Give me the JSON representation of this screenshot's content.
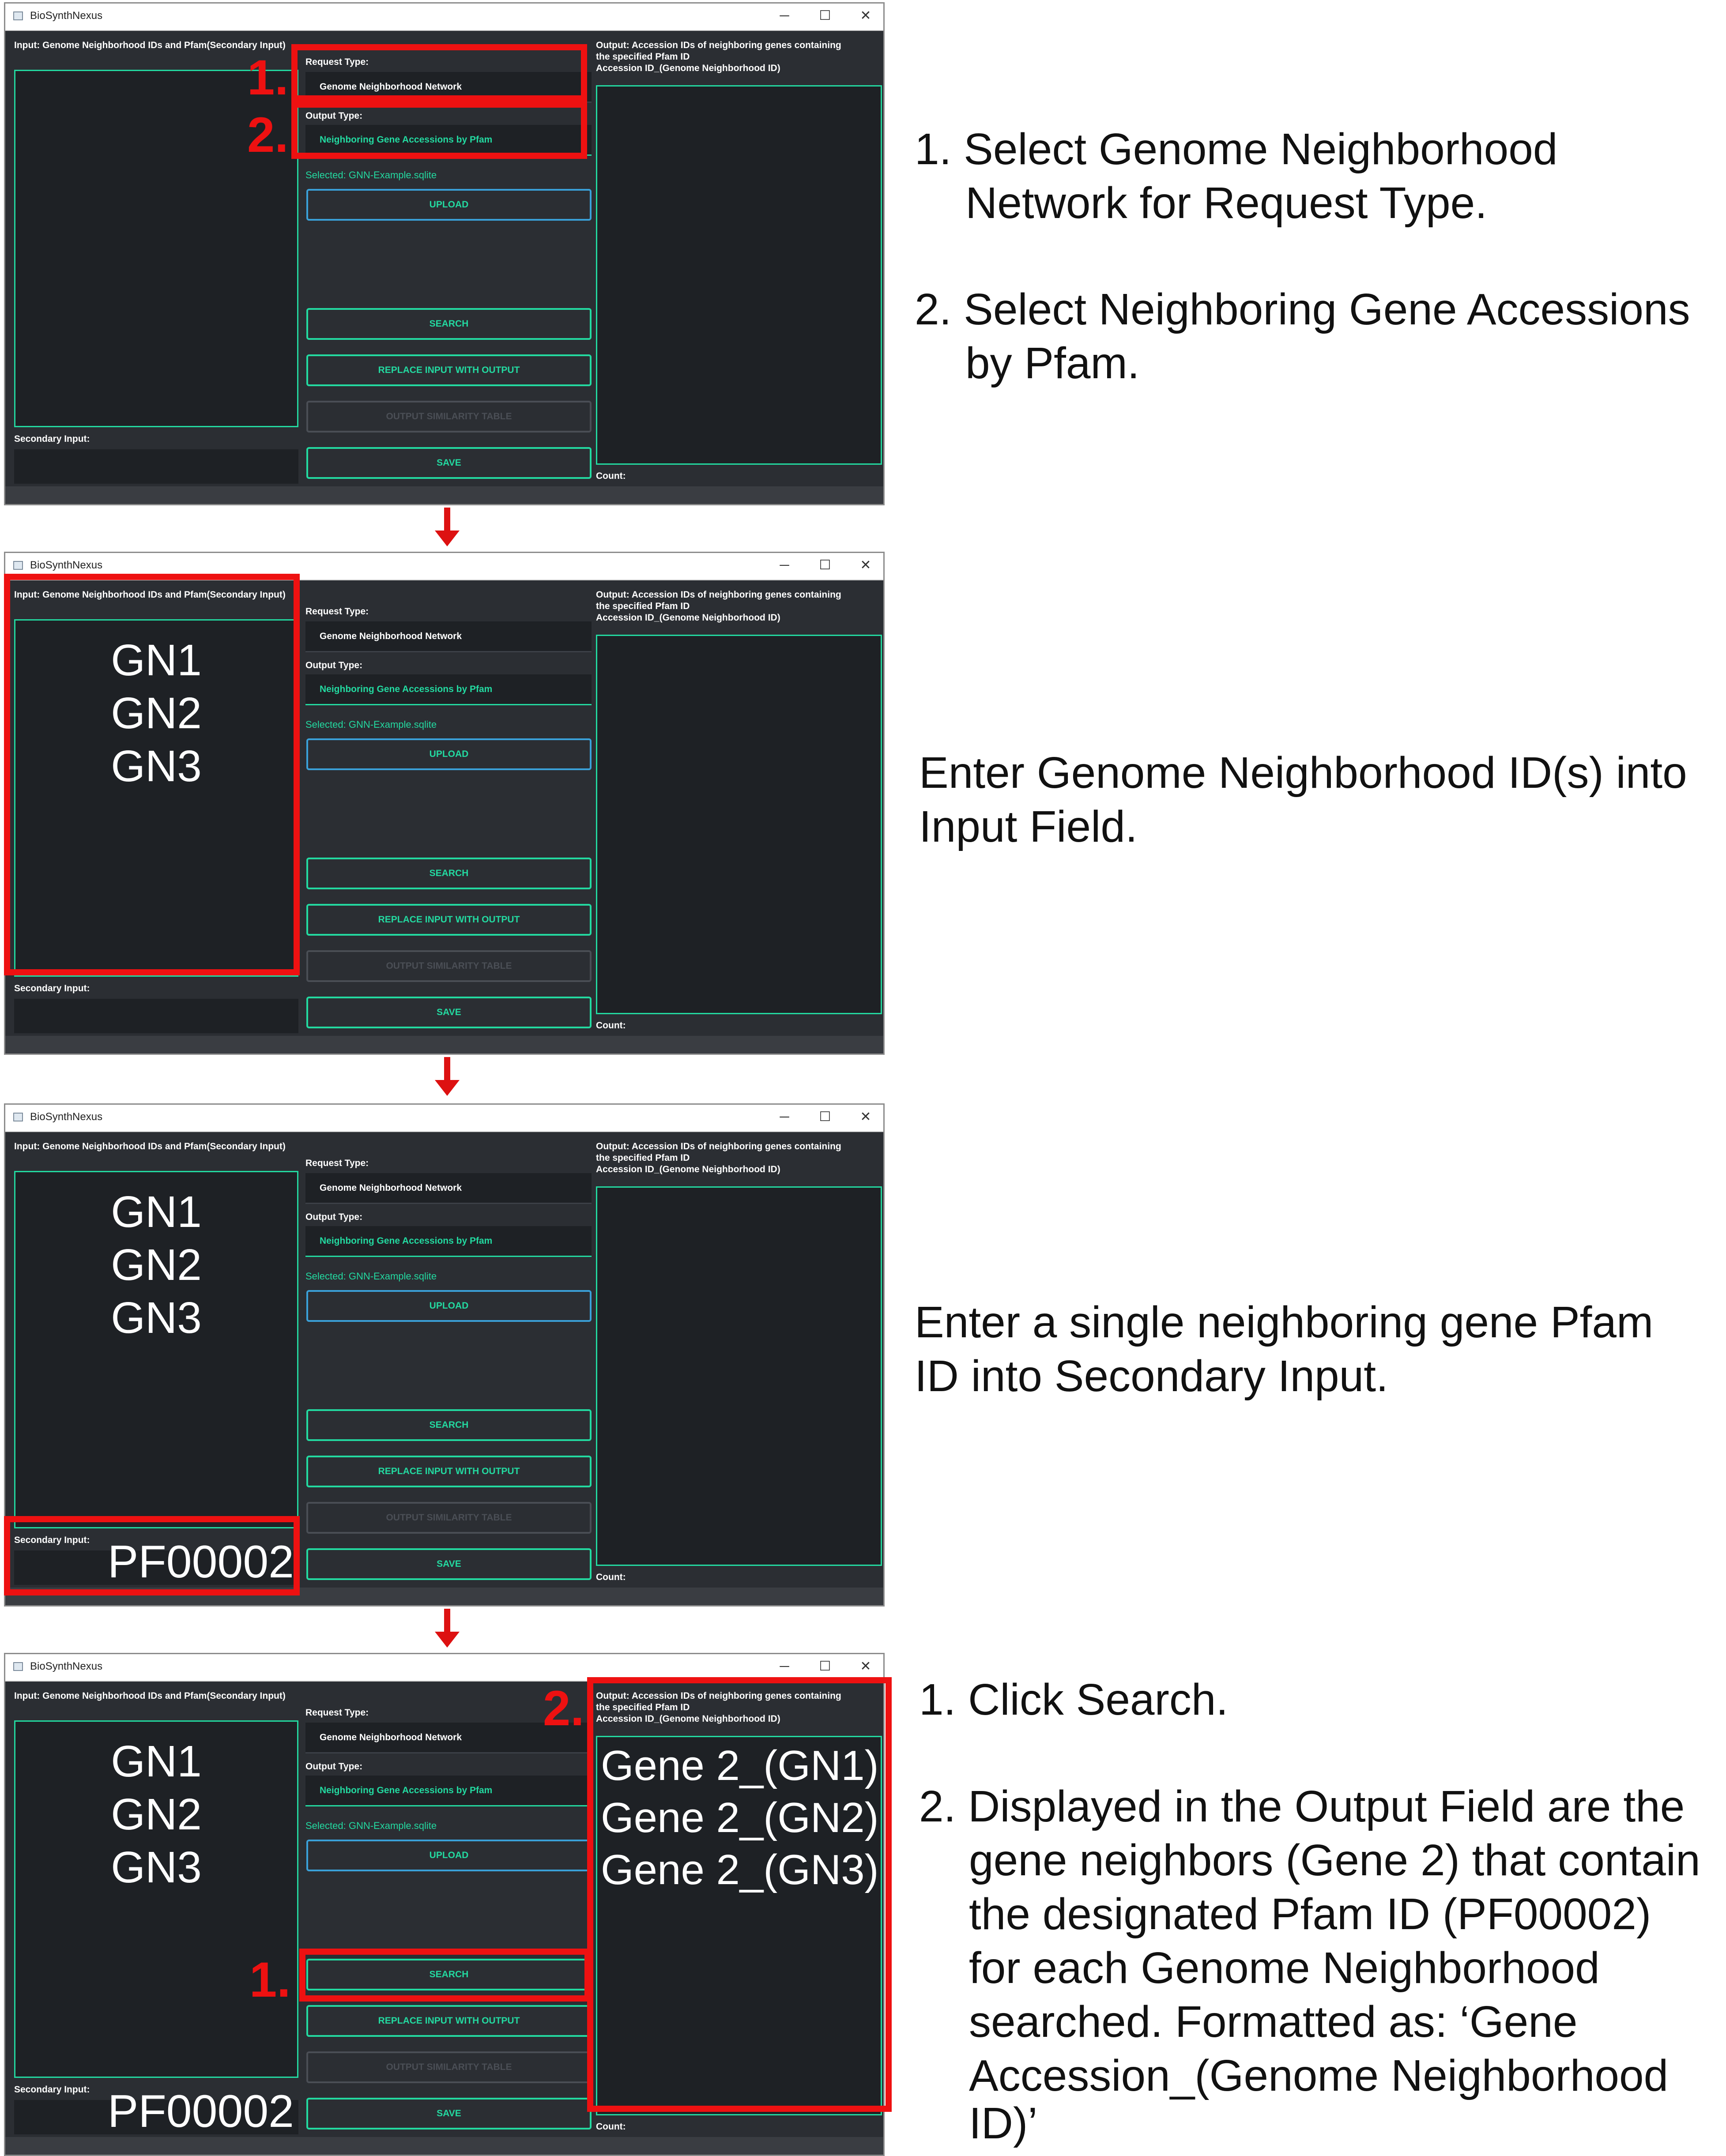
{
  "app": {
    "title": "BioSynthNexus",
    "win_min": "─",
    "win_max": "☐",
    "win_close": "✕"
  },
  "labels": {
    "input_label": "Input: Genome Neighborhood IDs and Pfam(Secondary Input)",
    "secondary_label": "Secondary Input:",
    "request_type_label": "Request Type:",
    "output_type_label": "Output Type:",
    "output_label_line1": "Output: Accession IDs of neighboring genes containing",
    "output_label_line2": "the specified Pfam ID",
    "output_label_line3": "Accession ID_(Genome Neighborhood ID)",
    "count_label": "Count:"
  },
  "controls": {
    "request_type_value": "Genome Neighborhood Network",
    "output_type_value": "Neighboring Gene Accessions by Pfam",
    "selected_file": "Selected: GNN-Example.sqlite",
    "upload": "UPLOAD",
    "search": "SEARCH",
    "replace": "REPLACE INPUT WITH OUTPUT",
    "similarity": "OUTPUT SIMILARITY TABLE",
    "save": "SAVE"
  },
  "input_ids": [
    "GN1",
    "GN2",
    "GN3"
  ],
  "secondary_value": "PF00002",
  "outputs": [
    "Gene 2_(GN1)",
    "Gene 2_(GN2)",
    "Gene 2_(GN3)"
  ],
  "markers": {
    "one": "1.",
    "two": "2."
  },
  "colors": {
    "accent": "#23d9a0",
    "panel_bg": "#2b2e33",
    "field_bg": "#1e2125",
    "highlight": "#ee1111"
  },
  "instructions": {
    "step1_a_1": "1. Select Genome Neighborhood",
    "step1_a_2": "Network for Request Type.",
    "step1_b_1": "2. Select Neighboring Gene Accessions",
    "step1_b_2": "by Pfam.",
    "step2_1": "Enter Genome Neighborhood ID(s) into",
    "step2_2": "Input Field.",
    "step3_1": "Enter a single neighboring gene Pfam",
    "step3_2": "ID into Secondary Input.",
    "step4_a": "1. Click Search.",
    "step4_b_1": "2. Displayed in the Output Field are the",
    "step4_b_2": "gene neighbors (Gene 2) that contain",
    "step4_b_3": "the designated Pfam ID (PF00002)",
    "step4_b_4": "for each Genome Neighborhood",
    "step4_b_5": "searched. Formatted as: ‘Gene",
    "step4_b_6": "Accession_(Genome Neighborhood",
    "step4_b_7": "ID)’"
  }
}
